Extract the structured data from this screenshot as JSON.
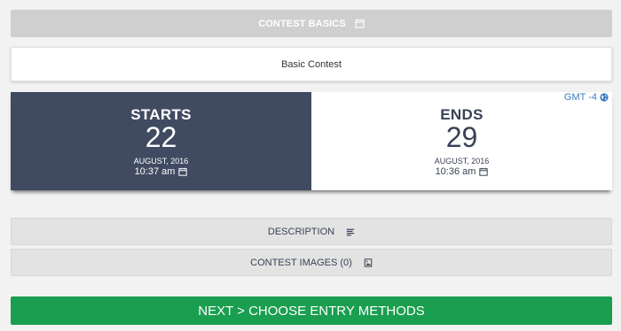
{
  "basics": {
    "title": "CONTEST BASICS",
    "icon": "calendar-icon"
  },
  "contest": {
    "name": "Basic Contest"
  },
  "timezone": {
    "label": "GMT -4",
    "icon": "globe-icon",
    "color": "#3b7ec2"
  },
  "start": {
    "heading": "STARTS",
    "day": "22",
    "month_year": "AUGUST, 2016",
    "time": "10:37 am",
    "icon": "calendar-icon",
    "bg_color": "#404a61"
  },
  "end": {
    "heading": "ENDS",
    "day": "29",
    "month_year": "AUGUST, 2016",
    "time": "10:36 am",
    "icon": "calendar-icon"
  },
  "sections": {
    "description": {
      "label": "DESCRIPTION",
      "icon": "text-lines-icon"
    },
    "images": {
      "label": "CONTEST IMAGES (0)",
      "icon": "image-icon"
    }
  },
  "next": {
    "label": "NEXT > CHOOSE ENTRY METHODS",
    "color": "#1a9e4f"
  }
}
